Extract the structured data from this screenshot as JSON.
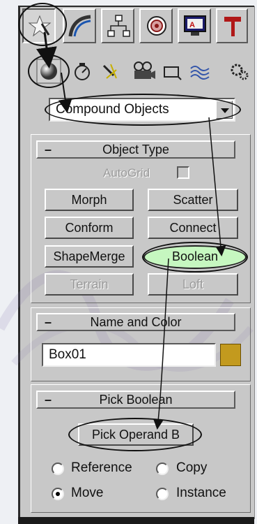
{
  "tabs": [
    {
      "name": "create-tab",
      "icon": "create-star-icon",
      "active": true
    },
    {
      "name": "modify-tab",
      "icon": "modify-arc-icon"
    },
    {
      "name": "hierarchy-tab",
      "icon": "hierarchy-icon"
    },
    {
      "name": "motion-tab",
      "icon": "motion-icon"
    },
    {
      "name": "display-tab",
      "icon": "display-icon"
    },
    {
      "name": "utilities-tab",
      "icon": "utilities-hammer-icon"
    }
  ],
  "create_categories": [
    {
      "name": "geometry",
      "icon": "sphere-icon",
      "active": true
    },
    {
      "name": "shapes",
      "icon": "shapes-icon"
    },
    {
      "name": "lights",
      "icon": "lights-icon"
    },
    {
      "name": "cameras",
      "icon": "camera-icon"
    },
    {
      "name": "helpers",
      "icon": "helpers-icon"
    },
    {
      "name": "space-warps",
      "icon": "spacewarp-icon"
    },
    {
      "name": "systems",
      "icon": "systems-gear-icon"
    }
  ],
  "object_category_dropdown": {
    "value": "Compound Objects"
  },
  "object_type": {
    "header": "Object Type",
    "collapse_glyph": "–",
    "autogrid_label": "AutoGrid",
    "buttons": {
      "morph": "Morph",
      "scatter": "Scatter",
      "conform": "Conform",
      "connect": "Connect",
      "shapemerge": "ShapeMerge",
      "boolean": "Boolean",
      "terrain": "Terrain",
      "loft": "Loft"
    }
  },
  "name_and_color": {
    "header": "Name and Color",
    "collapse_glyph": "–",
    "name_value": "Box01",
    "color": "#c39a1e"
  },
  "pick_boolean": {
    "header": "Pick Boolean",
    "collapse_glyph": "–",
    "pick_button": "Pick Operand B",
    "options": {
      "reference": "Reference",
      "copy": "Copy",
      "move": "Move",
      "instance": "Instance"
    },
    "selected": "Move"
  },
  "colors": {
    "panel": "#c8c8c8",
    "active_button": "#c6f7c0",
    "annotation": "#111111"
  }
}
